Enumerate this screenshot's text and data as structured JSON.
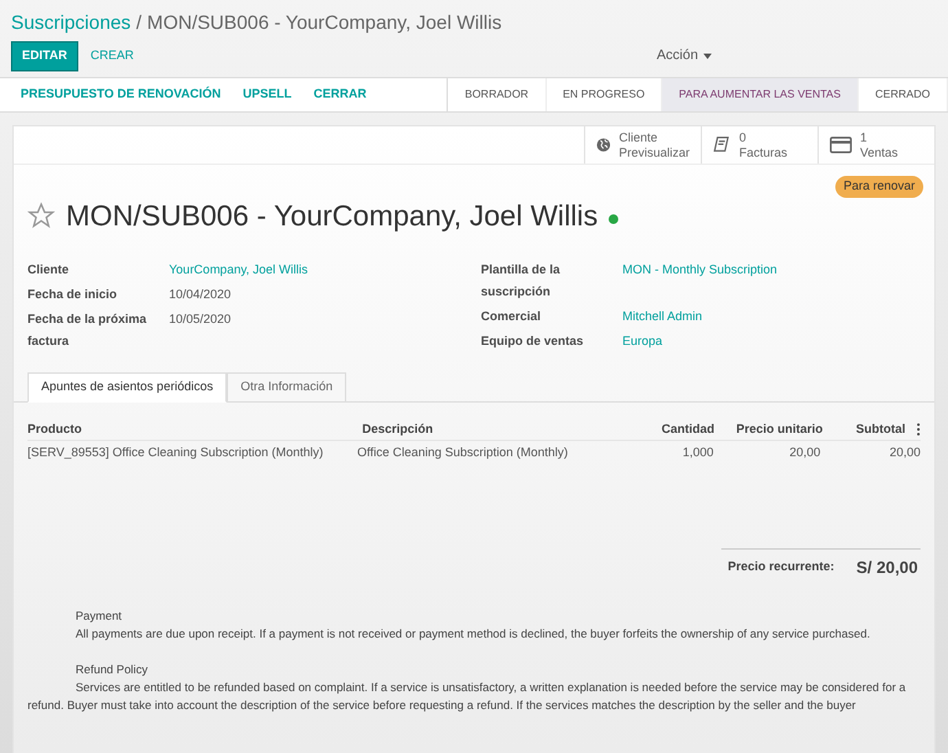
{
  "breadcrumb": {
    "parent": "Suscripciones",
    "separator": "/",
    "current": "MON/SUB006 - YourCompany, Joel Willis"
  },
  "toolbar": {
    "buttons": [
      {
        "label": "EDITAR",
        "kind": "primary"
      },
      {
        "label": "CREAR",
        "kind": "link"
      }
    ],
    "action": "Acción"
  },
  "header_buttons": [
    "PRESUPUESTO DE RENOVACIÓN",
    "UPSELL",
    "CERRAR"
  ],
  "stages": [
    {
      "label": "BORRADOR",
      "selected": false
    },
    {
      "label": "EN PROGRESO",
      "selected": false
    },
    {
      "label": "PARA AUMENTAR LAS VENTAS",
      "selected": true
    },
    {
      "label": "CERRADO",
      "selected": false
    }
  ],
  "smart_buttons": [
    {
      "kind": "globe",
      "value": "Cliente",
      "label": "Previsualizar"
    },
    {
      "kind": "book",
      "value": "0",
      "label": "Facturas"
    },
    {
      "kind": "card",
      "value": "1",
      "label": "Ventas"
    }
  ],
  "badge": "Para renovar",
  "title": {
    "text": "MON/SUB006 - YourCompany, Joel Willis",
    "starred": false,
    "online": true
  },
  "fields_left": [
    {
      "label": "Cliente",
      "value": "YourCompany, Joel Willis",
      "link": true
    },
    {
      "label": "Fecha de inicio",
      "value": "10/04/2020",
      "link": false
    },
    {
      "label": "Fecha de la próxima factura",
      "value": "10/05/2020",
      "link": false
    }
  ],
  "fields_right": [
    {
      "label": "Plantilla de la suscripción",
      "value": "MON - Monthly Subscription",
      "link": true
    },
    {
      "label": "Comercial",
      "value": "Mitchell Admin",
      "link": true
    },
    {
      "label": "Equipo de ventas",
      "value": "Europa",
      "link": true
    }
  ],
  "tabs": [
    {
      "label": "Apuntes de asientos periódicos",
      "selected": true
    },
    {
      "label": "Otra Información",
      "selected": false
    }
  ],
  "table": {
    "columns": [
      "Producto",
      "Descripción",
      "Cantidad",
      "Precio unitario",
      "Subtotal"
    ],
    "rows": [
      [
        "[SERV_89553] Office Cleaning Subscription (Monthly)",
        "Office Cleaning Subscription (Monthly)",
        "1,000",
        "20,00",
        "20,00"
      ]
    ]
  },
  "total": {
    "label": "Precio recurrente:",
    "value": "S/ 20,00"
  },
  "terms": [
    {
      "heading": "Payment",
      "body": "All payments are due upon receipt. If a payment is not received or payment method is declined, the buyer forfeits the ownership of any service purchased."
    },
    {
      "heading": "Refund Policy",
      "body": "Services are entitled to be refunded based on complaint. If a service is unsatisfactory, a written explanation is needed before the service may be considered for a refund. Buyer must take into account the description of the service before requesting a refund. If the services matches the description by the seller and the buyer"
    }
  ]
}
